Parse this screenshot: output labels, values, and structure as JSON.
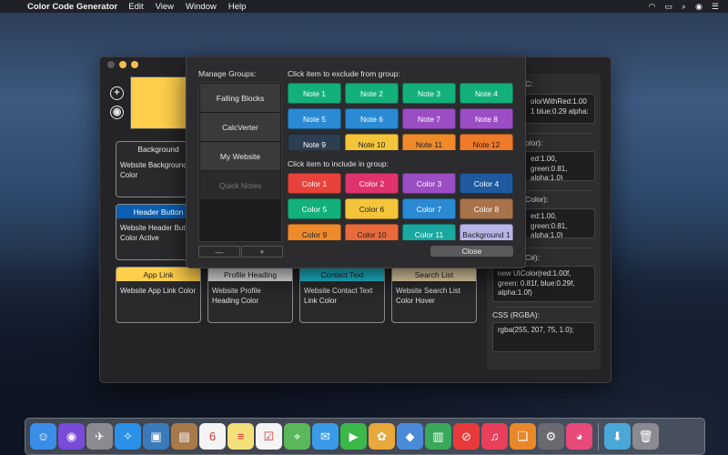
{
  "menubar": {
    "app_name": "Color Code Generator",
    "menus": [
      "Edit",
      "View",
      "Window",
      "Help"
    ]
  },
  "window": {
    "swatch_color": "#ffcf4b",
    "cards": [
      {
        "title": "Background",
        "desc": "Website Background Color",
        "header_color": "#2b2b2d",
        "text_color": "#e8e8e8"
      },
      {
        "title": "Header Button",
        "desc": "Website Header Button Color Active",
        "header_color": "#0a5fb4",
        "text_color": "#ffffff"
      },
      {
        "title": "App Link",
        "desc": "Website App Link Color",
        "header_color": "#ffcf4b",
        "text_color": "#222222"
      },
      {
        "title": "Profile Heading",
        "desc": "Website Profile Heading Color",
        "header_color": "#f2f2f2",
        "text_color": "#222222"
      },
      {
        "title": "Contact Text",
        "desc": "Website Contact Text Link Color",
        "header_color": "#1ec8e0",
        "text_color": "#222222"
      },
      {
        "title": "Search List",
        "desc": "Website Search List Color Hover",
        "header_color": "#f6e2b0",
        "text_color": "#222222"
      }
    ],
    "code_panel": {
      "sections": [
        {
          "label": "C:",
          "code": "olorWithRed:1.00 1 blue:0.29 alpha:"
        },
        {
          "label": "olor):",
          "code": "ed:1.00, green:0.81, alpha:1.0)"
        },
        {
          "label": "Color):",
          "code": "ed:1.00, green:0.81, alpha:1.0)"
        },
        {
          "label": "C#):",
          "code": "new UIColor(red:1.00f, green: 0.81f, blue:0.29f, alpha:1.0f)"
        },
        {
          "label": "CSS (RGBA):",
          "code": "rgba(255, 207, 75, 1.0);"
        }
      ]
    }
  },
  "groups_sheet": {
    "manage_label": "Manage Groups:",
    "exclude_label": "Click item to exclude from group:",
    "include_label": "Click item to include in group:",
    "groups": [
      {
        "name": "Falling Blocks",
        "dim": false
      },
      {
        "name": "CalcVerter",
        "dim": false
      },
      {
        "name": "My Website",
        "dim": false
      },
      {
        "name": "Quick Notes",
        "dim": true
      }
    ],
    "remove_label": "—",
    "add_label": "+",
    "close_label": "Close",
    "exclude_items": [
      {
        "label": "Note 1",
        "bg": "#13b07a",
        "fg": "#ffffff"
      },
      {
        "label": "Note 2",
        "bg": "#13b07a",
        "fg": "#ffffff"
      },
      {
        "label": "Note 3",
        "bg": "#13b07a",
        "fg": "#ffffff"
      },
      {
        "label": "Note 4",
        "bg": "#13b07a",
        "fg": "#ffffff"
      },
      {
        "label": "Note 5",
        "bg": "#2a8ad4",
        "fg": "#ffffff"
      },
      {
        "label": "Note 6",
        "bg": "#2a8ad4",
        "fg": "#ffffff"
      },
      {
        "label": "Note 7",
        "bg": "#9b4dc4",
        "fg": "#ffffff"
      },
      {
        "label": "Note 8",
        "bg": "#9b4dc4",
        "fg": "#ffffff"
      },
      {
        "label": "Note 9",
        "bg": "#2c3e52",
        "fg": "#ffffff"
      },
      {
        "label": "Note 10",
        "bg": "#f4c43a",
        "fg": "#222222"
      },
      {
        "label": "Note 11",
        "bg": "#ee8a2a",
        "fg": "#222222"
      },
      {
        "label": "Note 12",
        "bg": "#ee7a2a",
        "fg": "#222222"
      }
    ],
    "include_items": [
      {
        "label": "Color 1",
        "bg": "#e8423a",
        "fg": "#ffffff"
      },
      {
        "label": "Color 2",
        "bg": "#e0336e",
        "fg": "#ffffff"
      },
      {
        "label": "Color 3",
        "bg": "#9b4dc4",
        "fg": "#ffffff"
      },
      {
        "label": "Color 4",
        "bg": "#1f5aa0",
        "fg": "#ffffff"
      },
      {
        "label": "Color 5",
        "bg": "#13b07a",
        "fg": "#ffffff"
      },
      {
        "label": "Color 6",
        "bg": "#f4c43a",
        "fg": "#222222"
      },
      {
        "label": "Color 7",
        "bg": "#2a8ad4",
        "fg": "#ffffff"
      },
      {
        "label": "Color 8",
        "bg": "#a8734a",
        "fg": "#ffffff"
      },
      {
        "label": "Color 9",
        "bg": "#ee8a2a",
        "fg": "#222222"
      },
      {
        "label": "Color 10",
        "bg": "#e86a3a",
        "fg": "#222222"
      },
      {
        "label": "Color 11",
        "bg": "#18a8a0",
        "fg": "#ffffff"
      },
      {
        "label": "Background 1",
        "bg": "#b8b4e8",
        "fg": "#222222"
      }
    ]
  },
  "dock": {
    "apps": [
      {
        "name": "finder-icon",
        "glyph": "☺",
        "color": "#3a8ee8"
      },
      {
        "name": "siri-icon",
        "glyph": "◉",
        "color": "#7a4ad8"
      },
      {
        "name": "launchpad-icon",
        "glyph": "✈",
        "color": "#8a8a90"
      },
      {
        "name": "safari-icon",
        "glyph": "✧",
        "color": "#2a90e8"
      },
      {
        "name": "photo-viewer-icon",
        "glyph": "▣",
        "color": "#3a7ab8"
      },
      {
        "name": "notebook-icon",
        "glyph": "▤",
        "color": "#a87a4a"
      },
      {
        "name": "calendar-icon",
        "glyph": "6",
        "color": "#f4f4f4"
      },
      {
        "name": "notes-icon",
        "glyph": "≡",
        "color": "#f4e07a"
      },
      {
        "name": "reminders-icon",
        "glyph": "☑",
        "color": "#f4f4f4"
      },
      {
        "name": "maps-icon",
        "glyph": "⌖",
        "color": "#5ab85a"
      },
      {
        "name": "messages-icon",
        "glyph": "✉",
        "color": "#3a9ae8"
      },
      {
        "name": "facetime-icon",
        "glyph": "▶",
        "color": "#3ab84a"
      },
      {
        "name": "photos-icon",
        "glyph": "✿",
        "color": "#e8a83a"
      },
      {
        "name": "keynote-icon",
        "glyph": "◆",
        "color": "#4a8ad8"
      },
      {
        "name": "numbers-icon",
        "glyph": "▥",
        "color": "#3aa85a"
      },
      {
        "name": "news-icon",
        "glyph": "⊘",
        "color": "#e83a3a"
      },
      {
        "name": "music-icon",
        "glyph": "♫",
        "color": "#e8405a"
      },
      {
        "name": "books-icon",
        "glyph": "❑",
        "color": "#e8882a"
      },
      {
        "name": "system-preferences-icon",
        "glyph": "⚙",
        "color": "#6a6a70"
      },
      {
        "name": "color-code-generator-icon",
        "glyph": "◕",
        "color": "#e84a7a"
      },
      {
        "name": "downloads-folder-icon",
        "glyph": "⬇",
        "color": "#4aa8d8"
      },
      {
        "name": "trash-icon",
        "glyph": "🗑",
        "color": "#8a8a90"
      }
    ]
  }
}
